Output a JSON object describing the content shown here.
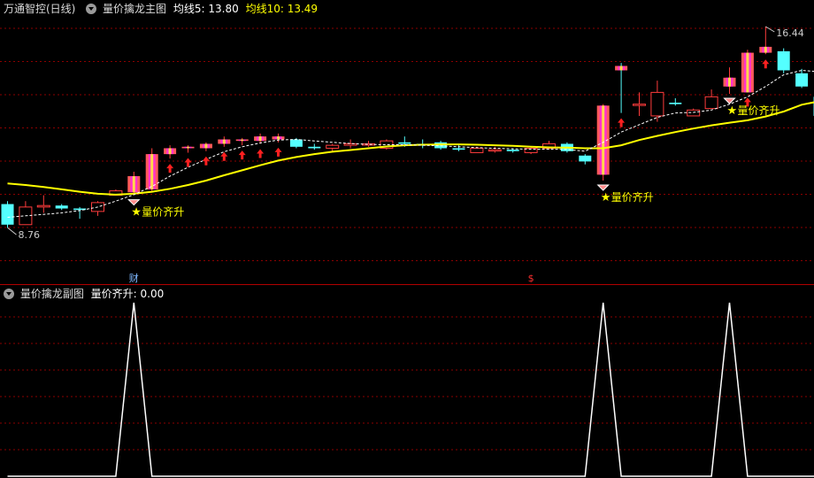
{
  "main_header": {
    "stock": "万通智控(日线)",
    "indicator": "量价擒龙主图",
    "ma5_label": "均线5: 13.80",
    "ma10_label": "均线10: 13.49"
  },
  "sub_header": {
    "indicator": "量价擒龙副图",
    "value_label": "量价齐升: 0.00"
  },
  "price_max_label": "16.44",
  "price_min_label": "8.76",
  "event_markers": [
    {
      "text": "财",
      "color": "#7fb8ff",
      "index": 7
    },
    {
      "text": "$",
      "color": "#ff3030",
      "index": 29
    }
  ],
  "signal_labels": [
    {
      "text": "量价齐升",
      "index": 7
    },
    {
      "text": "量价齐升",
      "index": 33
    },
    {
      "text": "量价齐升",
      "index": 40
    }
  ],
  "colors": {
    "up": "#ff3c3c",
    "down": "#54ffff",
    "ma5": "#ffffff",
    "ma10": "#ffff00",
    "grid": "#8b0000",
    "signal": "#ffff00",
    "highlight_bar": "#ff33cc",
    "arrow": "#ff2020"
  },
  "chart_data": {
    "type": "candlestick",
    "price_range": [
      8.76,
      16.44
    ],
    "candles": [
      {
        "o": 10.4,
        "h": 10.5,
        "l": 9.6,
        "c": 9.7,
        "hl": false
      },
      {
        "o": 9.7,
        "h": 10.5,
        "l": 9.8,
        "c": 10.3,
        "hl": false
      },
      {
        "o": 10.3,
        "h": 10.7,
        "l": 10.1,
        "c": 10.35,
        "hl": false
      },
      {
        "o": 10.35,
        "h": 10.4,
        "l": 10.2,
        "c": 10.25,
        "hl": false
      },
      {
        "o": 10.25,
        "h": 10.3,
        "l": 9.9,
        "c": 10.2,
        "hl": false
      },
      {
        "o": 10.15,
        "h": 10.5,
        "l": 10.0,
        "c": 10.45,
        "hl": false
      },
      {
        "o": 10.7,
        "h": 10.9,
        "l": 10.7,
        "c": 10.85,
        "hl": false
      },
      {
        "o": 10.8,
        "h": 11.5,
        "l": 10.7,
        "c": 11.35,
        "hl": true
      },
      {
        "o": 10.9,
        "h": 12.3,
        "l": 10.8,
        "c": 12.1,
        "hl": true
      },
      {
        "o": 12.1,
        "h": 12.4,
        "l": 11.95,
        "c": 12.3,
        "hl": true
      },
      {
        "o": 12.3,
        "h": 12.4,
        "l": 12.15,
        "c": 12.35,
        "hl": true
      },
      {
        "o": 12.3,
        "h": 12.5,
        "l": 12.2,
        "c": 12.45,
        "hl": true
      },
      {
        "o": 12.45,
        "h": 12.7,
        "l": 12.35,
        "c": 12.6,
        "hl": true
      },
      {
        "o": 12.55,
        "h": 12.65,
        "l": 12.4,
        "c": 12.6,
        "hl": true
      },
      {
        "o": 12.55,
        "h": 12.8,
        "l": 12.45,
        "c": 12.7,
        "hl": true
      },
      {
        "o": 12.6,
        "h": 12.8,
        "l": 12.5,
        "c": 12.7,
        "hl": true
      },
      {
        "o": 12.6,
        "h": 12.65,
        "l": 12.3,
        "c": 12.35,
        "hl": false
      },
      {
        "o": 12.35,
        "h": 12.45,
        "l": 12.25,
        "c": 12.3,
        "hl": false
      },
      {
        "o": 12.3,
        "h": 12.45,
        "l": 12.2,
        "c": 12.4,
        "hl": false
      },
      {
        "o": 12.4,
        "h": 12.6,
        "l": 12.3,
        "c": 12.45,
        "hl": false
      },
      {
        "o": 12.45,
        "h": 12.55,
        "l": 12.35,
        "c": 12.45,
        "hl": false
      },
      {
        "o": 12.3,
        "h": 12.6,
        "l": 12.25,
        "c": 12.55,
        "hl": false
      },
      {
        "o": 12.5,
        "h": 12.7,
        "l": 12.35,
        "c": 12.45,
        "hl": false
      },
      {
        "o": 12.45,
        "h": 12.6,
        "l": 12.3,
        "c": 12.4,
        "hl": false
      },
      {
        "o": 12.5,
        "h": 12.55,
        "l": 12.25,
        "c": 12.3,
        "hl": false
      },
      {
        "o": 12.3,
        "h": 12.4,
        "l": 12.2,
        "c": 12.25,
        "hl": false
      },
      {
        "o": 12.15,
        "h": 12.35,
        "l": 12.15,
        "c": 12.3,
        "hl": false
      },
      {
        "o": 12.25,
        "h": 12.35,
        "l": 12.15,
        "c": 12.25,
        "hl": false
      },
      {
        "o": 12.25,
        "h": 12.3,
        "l": 12.15,
        "c": 12.2,
        "hl": false
      },
      {
        "o": 12.15,
        "h": 12.35,
        "l": 12.1,
        "c": 12.3,
        "hl": false
      },
      {
        "o": 12.3,
        "h": 12.55,
        "l": 12.25,
        "c": 12.45,
        "hl": false
      },
      {
        "o": 12.45,
        "h": 12.5,
        "l": 12.15,
        "c": 12.2,
        "hl": false
      },
      {
        "o": 12.05,
        "h": 12.1,
        "l": 11.75,
        "c": 11.85,
        "hl": false
      },
      {
        "o": 11.4,
        "h": 13.8,
        "l": 11.2,
        "c": 13.75,
        "hl": true
      },
      {
        "o": 15.1,
        "h": 15.2,
        "l": 13.5,
        "c": 14.95,
        "hl": true
      },
      {
        "o": 13.8,
        "h": 14.2,
        "l": 13.4,
        "c": 13.8,
        "hl": false
      },
      {
        "o": 13.4,
        "h": 14.6,
        "l": 13.2,
        "c": 14.2,
        "hl": false
      },
      {
        "o": 13.85,
        "h": 14.0,
        "l": 13.75,
        "c": 13.8,
        "hl": false
      },
      {
        "o": 13.4,
        "h": 13.65,
        "l": 13.4,
        "c": 13.6,
        "hl": false
      },
      {
        "o": 13.65,
        "h": 14.3,
        "l": 13.65,
        "c": 14.05,
        "hl": false
      },
      {
        "o": 14.4,
        "h": 15.05,
        "l": 14.15,
        "c": 14.7,
        "hl": true
      },
      {
        "o": 14.2,
        "h": 15.65,
        "l": 14.2,
        "c": 15.55,
        "hl": true
      },
      {
        "o": 15.55,
        "h": 16.44,
        "l": 15.5,
        "c": 15.75,
        "hl": true
      },
      {
        "o": 15.6,
        "h": 15.7,
        "l": 14.85,
        "c": 14.95,
        "hl": false
      },
      {
        "o": 14.85,
        "h": 15.0,
        "l": 14.35,
        "c": 14.4,
        "hl": false
      },
      {
        "o": 14.05,
        "h": 14.2,
        "l": 13.35,
        "c": 13.4,
        "hl": false
      }
    ],
    "ma5": [
      9.95,
      10.0,
      10.05,
      10.1,
      10.18,
      10.3,
      10.5,
      10.72,
      11.0,
      11.35,
      11.65,
      11.92,
      12.18,
      12.35,
      12.48,
      12.58,
      12.6,
      12.55,
      12.5,
      12.46,
      12.43,
      12.42,
      12.42,
      12.4,
      12.38,
      12.35,
      12.32,
      12.3,
      12.28,
      12.27,
      12.27,
      12.26,
      12.2,
      12.5,
      12.85,
      13.1,
      13.35,
      13.5,
      13.52,
      13.6,
      13.8,
      14.05,
      14.4,
      14.8,
      14.95,
      14.9
    ],
    "ma10": [
      11.1,
      11.05,
      10.98,
      10.9,
      10.82,
      10.75,
      10.72,
      10.75,
      10.82,
      10.92,
      11.05,
      11.2,
      11.38,
      11.55,
      11.72,
      11.88,
      12.0,
      12.1,
      12.18,
      12.24,
      12.3,
      12.36,
      12.4,
      12.42,
      12.43,
      12.43,
      12.42,
      12.4,
      12.38,
      12.35,
      12.33,
      12.32,
      12.3,
      12.3,
      12.4,
      12.58,
      12.72,
      12.85,
      12.97,
      13.08,
      13.17,
      13.25,
      13.38,
      13.55,
      13.78,
      13.9
    ],
    "red_arrow_indices": [
      9,
      10,
      11,
      12,
      13,
      14,
      15,
      34,
      41,
      42
    ],
    "sub_signal": [
      {
        "index": 7,
        "value": 1
      },
      {
        "index": 33,
        "value": 1
      },
      {
        "index": 40,
        "value": 1
      }
    ],
    "sub_range": [
      0,
      1
    ]
  }
}
